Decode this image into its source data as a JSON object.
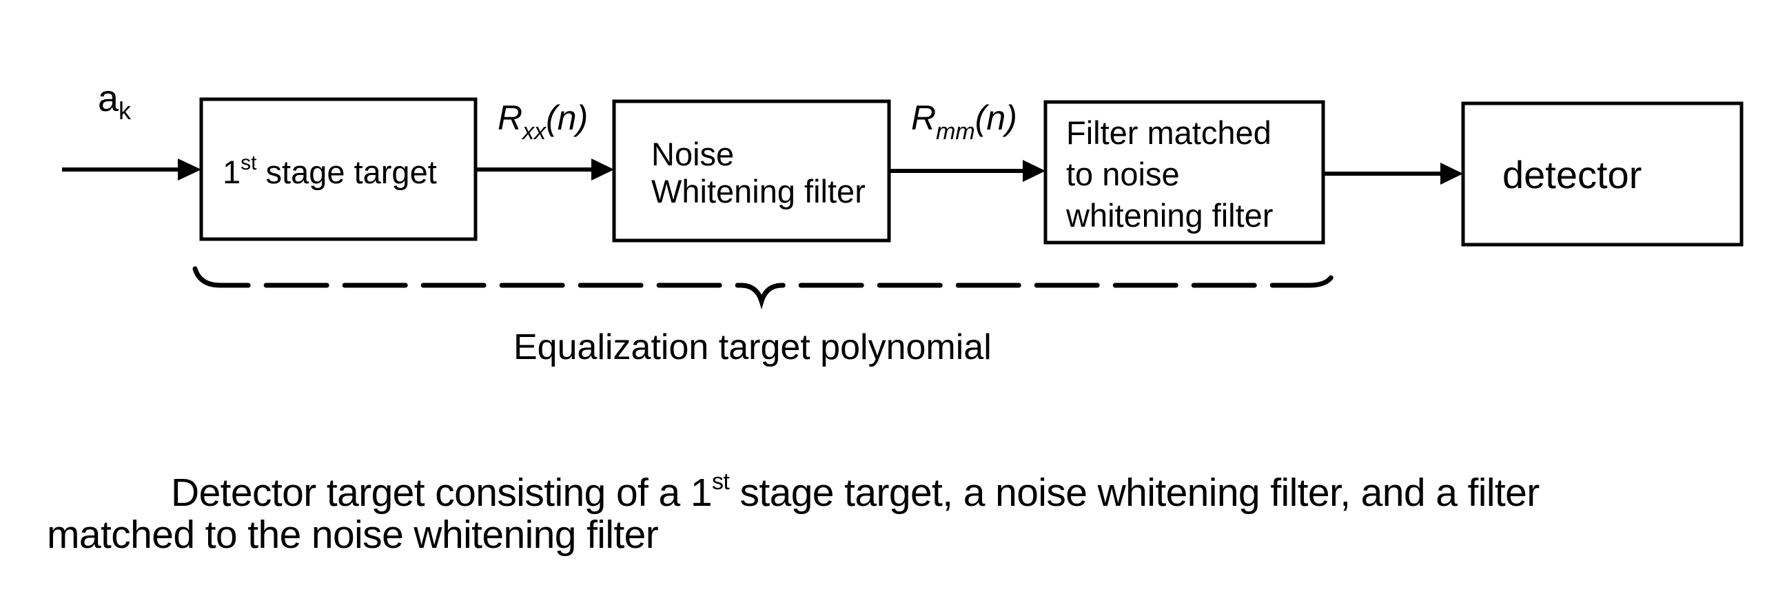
{
  "diagram": {
    "input_signal": {
      "base": "a",
      "subscript": "k"
    },
    "blocks": [
      {
        "id": "first-stage-target",
        "lines": [
          "1",
          "st",
          " stage target"
        ]
      },
      {
        "id": "noise-whitening-filter",
        "lines": [
          "Noise",
          "Whitening filter"
        ]
      },
      {
        "id": "matched-filter",
        "lines": [
          "Filter matched",
          "to noise",
          "whitening filter"
        ]
      },
      {
        "id": "detector",
        "lines": [
          "detector"
        ]
      }
    ],
    "edge_labels": [
      {
        "base": "R",
        "subscript": "xx",
        "suffix": "(n)"
      },
      {
        "base": "R",
        "subscript": "mm",
        "suffix": "(n)"
      }
    ],
    "brace_label": "Equalization target polynomial",
    "caption": {
      "line1_pre": "Detector target consisting of a 1",
      "line1_sup": "st",
      "line1_post": " stage target, a noise whitening filter, and a filter",
      "line2": "matched to the noise whitening filter"
    },
    "colors": {
      "ink": "#000000",
      "background": "#ffffff"
    }
  }
}
